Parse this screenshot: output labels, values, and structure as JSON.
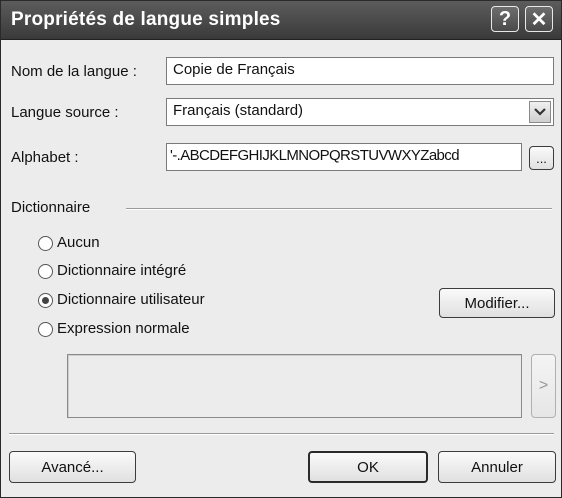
{
  "window": {
    "title": "Propriétés de langue simples",
    "help_label": "?",
    "close_label": "✕"
  },
  "form": {
    "name_label": "Nom de la langue :",
    "name_value": "Copie de Français",
    "source_label": "Langue source :",
    "source_value": "Français (standard)",
    "alphabet_label": "Alphabet :",
    "alphabet_value": "'-.ABCDEFGHIJKLMNOPQRSTUVWXYZabcd",
    "alphabet_browse_label": "..."
  },
  "dictionary": {
    "section_label": "Dictionnaire",
    "options": [
      {
        "label": "Aucun",
        "selected": false
      },
      {
        "label": "Dictionnaire intégré",
        "selected": false
      },
      {
        "label": "Dictionnaire utilisateur",
        "selected": true
      },
      {
        "label": "Expression normale",
        "selected": false
      }
    ],
    "modify_label": "Modifier...",
    "expand_label": ">"
  },
  "buttons": {
    "advanced_label": "Avancé...",
    "ok_label": "OK",
    "cancel_label": "Annuler"
  }
}
